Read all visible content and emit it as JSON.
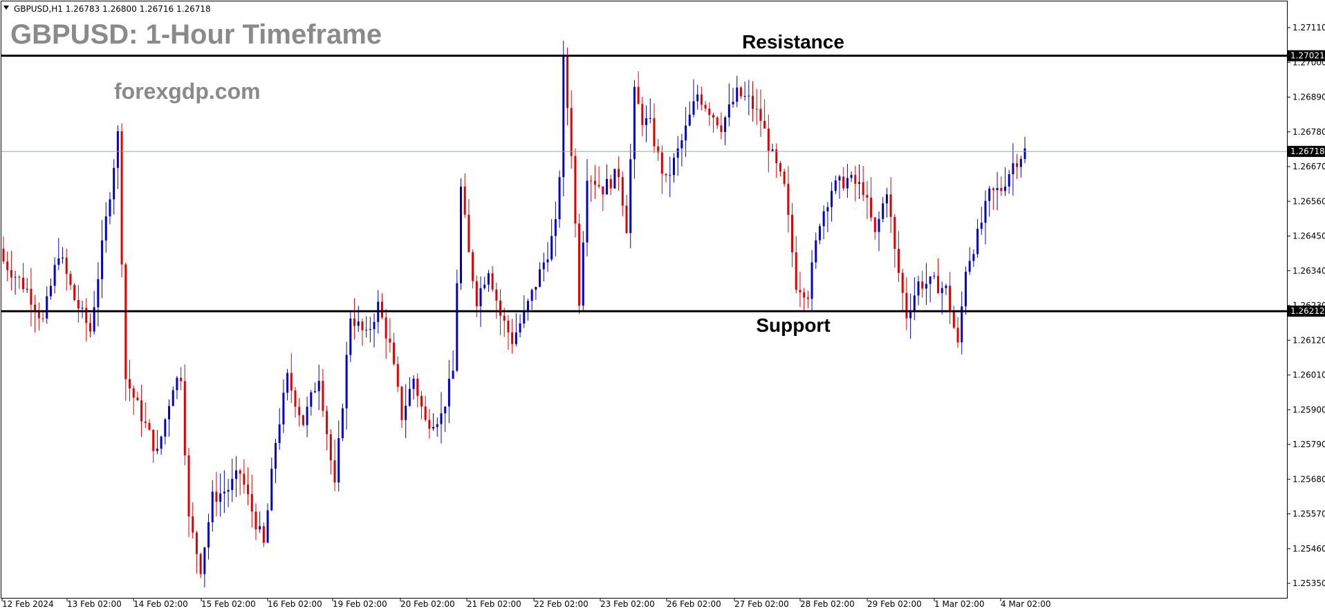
{
  "header": {
    "symbol_info": "GBPUSD,H1  1.26783 1.26800 1.26716 1.26718"
  },
  "title": "GBPUSD: 1-Hour Timeframe",
  "watermark": "forexgdp.com",
  "colors": {
    "bull": "#0000c8",
    "bear": "#e00000",
    "level_line": "#000000",
    "current_line": "#8ba3b5",
    "tag_bg": "#000000"
  },
  "chart_data": {
    "type": "candlestick",
    "symbol": "GBPUSD",
    "timeframe": "H1",
    "ylim": [
      1.253,
      1.2715
    ],
    "y_ticks": [
      "1.27110",
      "1.27000",
      "1.26890",
      "1.26780",
      "1.26670",
      "1.26560",
      "1.26450",
      "1.26340",
      "1.26230",
      "1.26120",
      "1.26010",
      "1.25900",
      "1.25790",
      "1.25680",
      "1.25570",
      "1.25460",
      "1.25350"
    ],
    "x_labels": [
      "12 Feb 2024",
      "13 Feb 02:00",
      "14 Feb 02:00",
      "15 Feb 02:00",
      "16 Feb 02:00",
      "19 Feb 02:00",
      "20 Feb 02:00",
      "21 Feb 02:00",
      "22 Feb 02:00",
      "23 Feb 02:00",
      "26 Feb 02:00",
      "27 Feb 02:00",
      "28 Feb 02:00",
      "29 Feb 02:00",
      "1 Mar 02:00",
      "4 Mar 02:00"
    ],
    "levels": [
      {
        "label": "Resistance",
        "price": 1.27021,
        "tag": "1.27021"
      },
      {
        "label": "Support",
        "price": 1.26212,
        "tag": "1.26212"
      }
    ],
    "current_price": {
      "price": 1.26718,
      "tag": "1.26718"
    },
    "waypoints": [
      [
        0,
        1.2637
      ],
      [
        6,
        1.2628
      ],
      [
        10,
        1.2618
      ],
      [
        14,
        1.264
      ],
      [
        18,
        1.2625
      ],
      [
        22,
        1.2615
      ],
      [
        26,
        1.265
      ],
      [
        29,
        1.2677
      ],
      [
        31,
        1.26
      ],
      [
        35,
        1.2588
      ],
      [
        39,
        1.2576
      ],
      [
        43,
        1.2598
      ],
      [
        45,
        1.2601
      ],
      [
        47,
        1.2555
      ],
      [
        50,
        1.254
      ],
      [
        53,
        1.2562
      ],
      [
        57,
        1.2565
      ],
      [
        60,
        1.257
      ],
      [
        63,
        1.2558
      ],
      [
        66,
        1.2547
      ],
      [
        69,
        1.258
      ],
      [
        72,
        1.26
      ],
      [
        76,
        1.2586
      ],
      [
        80,
        1.2601
      ],
      [
        84,
        1.2565
      ],
      [
        88,
        1.262
      ],
      [
        92,
        1.2613
      ],
      [
        95,
        1.2623
      ],
      [
        98,
        1.261
      ],
      [
        101,
        1.2588
      ],
      [
        104,
        1.26
      ],
      [
        107,
        1.2586
      ],
      [
        111,
        1.2588
      ],
      [
        114,
        1.2602
      ],
      [
        116,
        1.266
      ],
      [
        118,
        1.2639
      ],
      [
        120,
        1.2625
      ],
      [
        123,
        1.2635
      ],
      [
        126,
        1.262
      ],
      [
        129,
        1.2612
      ],
      [
        132,
        1.262
      ],
      [
        135,
        1.263
      ],
      [
        138,
        1.264
      ],
      [
        140,
        1.2648
      ],
      [
        141,
        1.2665
      ],
      [
        142,
        1.27
      ],
      [
        144,
        1.2672
      ],
      [
        146,
        1.2625
      ],
      [
        148,
        1.2665
      ],
      [
        152,
        1.266
      ],
      [
        156,
        1.2665
      ],
      [
        158,
        1.2648
      ],
      [
        160,
        1.269
      ],
      [
        162,
        1.2682
      ],
      [
        164,
        1.268
      ],
      [
        166,
        1.267
      ],
      [
        168,
        1.2662
      ],
      [
        172,
        1.2675
      ],
      [
        176,
        1.269
      ],
      [
        179,
        1.2685
      ],
      [
        182,
        1.268
      ],
      [
        186,
        1.269
      ],
      [
        189,
        1.2688
      ],
      [
        192,
        1.2682
      ],
      [
        195,
        1.267
      ],
      [
        198,
        1.266
      ],
      [
        201,
        1.263
      ],
      [
        204,
        1.2627
      ],
      [
        207,
        1.265
      ],
      [
        210,
        1.266
      ],
      [
        214,
        1.2663
      ],
      [
        218,
        1.266
      ],
      [
        221,
        1.2645
      ],
      [
        224,
        1.266
      ],
      [
        226,
        1.264
      ],
      [
        229,
        1.262
      ],
      [
        232,
        1.263
      ],
      [
        236,
        1.263
      ],
      [
        239,
        1.2628
      ],
      [
        242,
        1.261
      ],
      [
        244,
        1.2635
      ],
      [
        247,
        1.2645
      ],
      [
        250,
        1.2658
      ],
      [
        253,
        1.266
      ],
      [
        256,
        1.2668
      ],
      [
        259,
        1.2672
      ]
    ]
  }
}
